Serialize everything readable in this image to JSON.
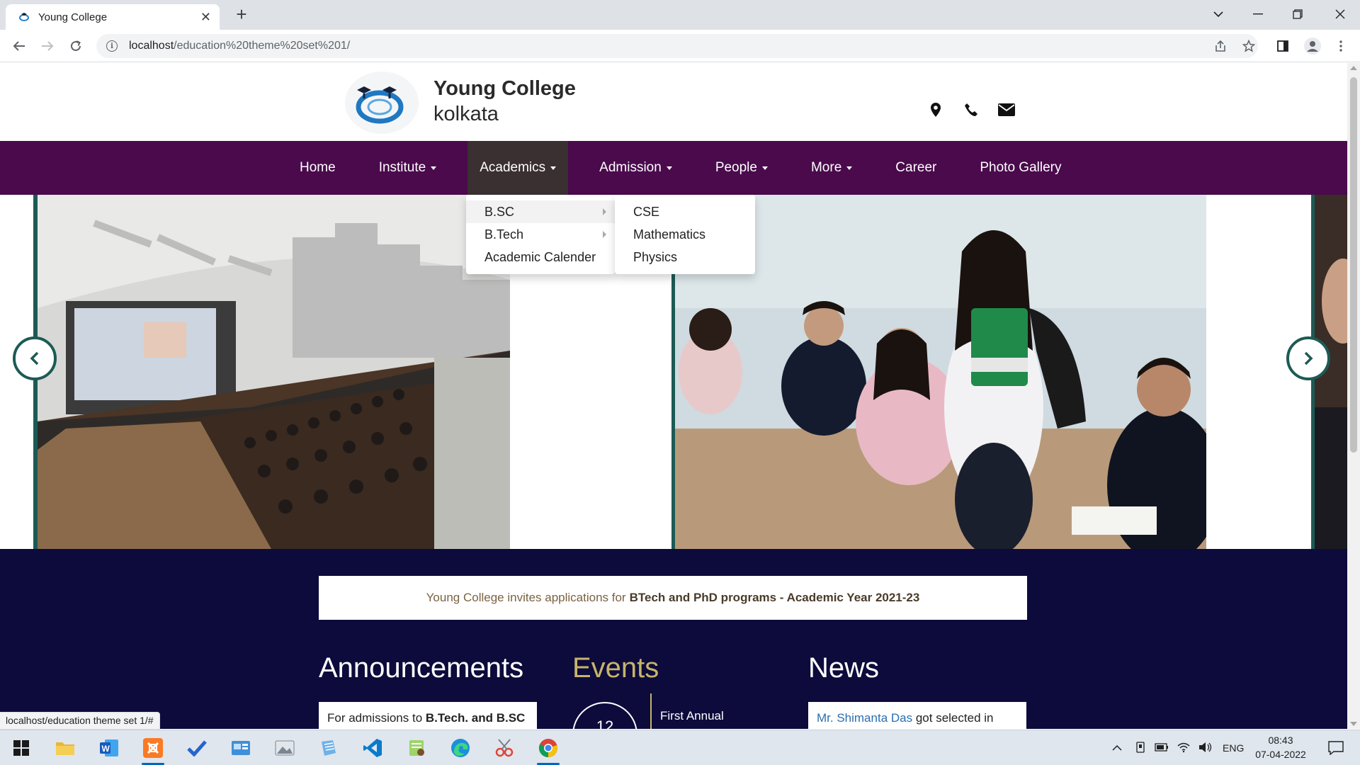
{
  "browser": {
    "tab_title": "Young College",
    "url_host": "localhost",
    "url_path": "/education%20theme%20set%201/",
    "status_url": "localhost/education theme set 1/#"
  },
  "site": {
    "brand_name": "Young College",
    "brand_city": "kolkata"
  },
  "nav": {
    "items": [
      {
        "label": "Home"
      },
      {
        "label": "Institute"
      },
      {
        "label": "Academics"
      },
      {
        "label": "Admission"
      },
      {
        "label": "People"
      },
      {
        "label": "More"
      },
      {
        "label": "Career"
      },
      {
        "label": "Photo Gallery"
      }
    ]
  },
  "academics_menu": {
    "items": [
      {
        "label": "B.SC"
      },
      {
        "label": "B.Tech"
      },
      {
        "label": "Academic Calender"
      }
    ],
    "bsc_submenu": [
      {
        "label": "CSE"
      },
      {
        "label": "Mathematics"
      },
      {
        "label": "Physics"
      }
    ]
  },
  "banner": {
    "prefix": "Young College invites applications for",
    "highlight": "BTech and PhD programs - Academic Year 2021-23"
  },
  "sections": {
    "announcements": {
      "heading": "Announcements",
      "card_prefix": "For admissions to",
      "card_bold": "B.Tech. and B.SC"
    },
    "events": {
      "heading": "Events",
      "day": "12",
      "title": "First Annual"
    },
    "news": {
      "heading": "News",
      "link": "Mr. Shimanta Das",
      "text": "got selected in"
    }
  },
  "taskbar": {
    "lang": "ENG",
    "time": "08:43",
    "date": "07-04-2022"
  },
  "colors": {
    "nav_bg": "#4a0a4c",
    "nav_active": "#3a2f31",
    "dark_section": "#0d0b3b",
    "events_heading": "#c7b46b",
    "slider_accent": "#1d5a55",
    "link_blue": "#2a6fb0"
  }
}
